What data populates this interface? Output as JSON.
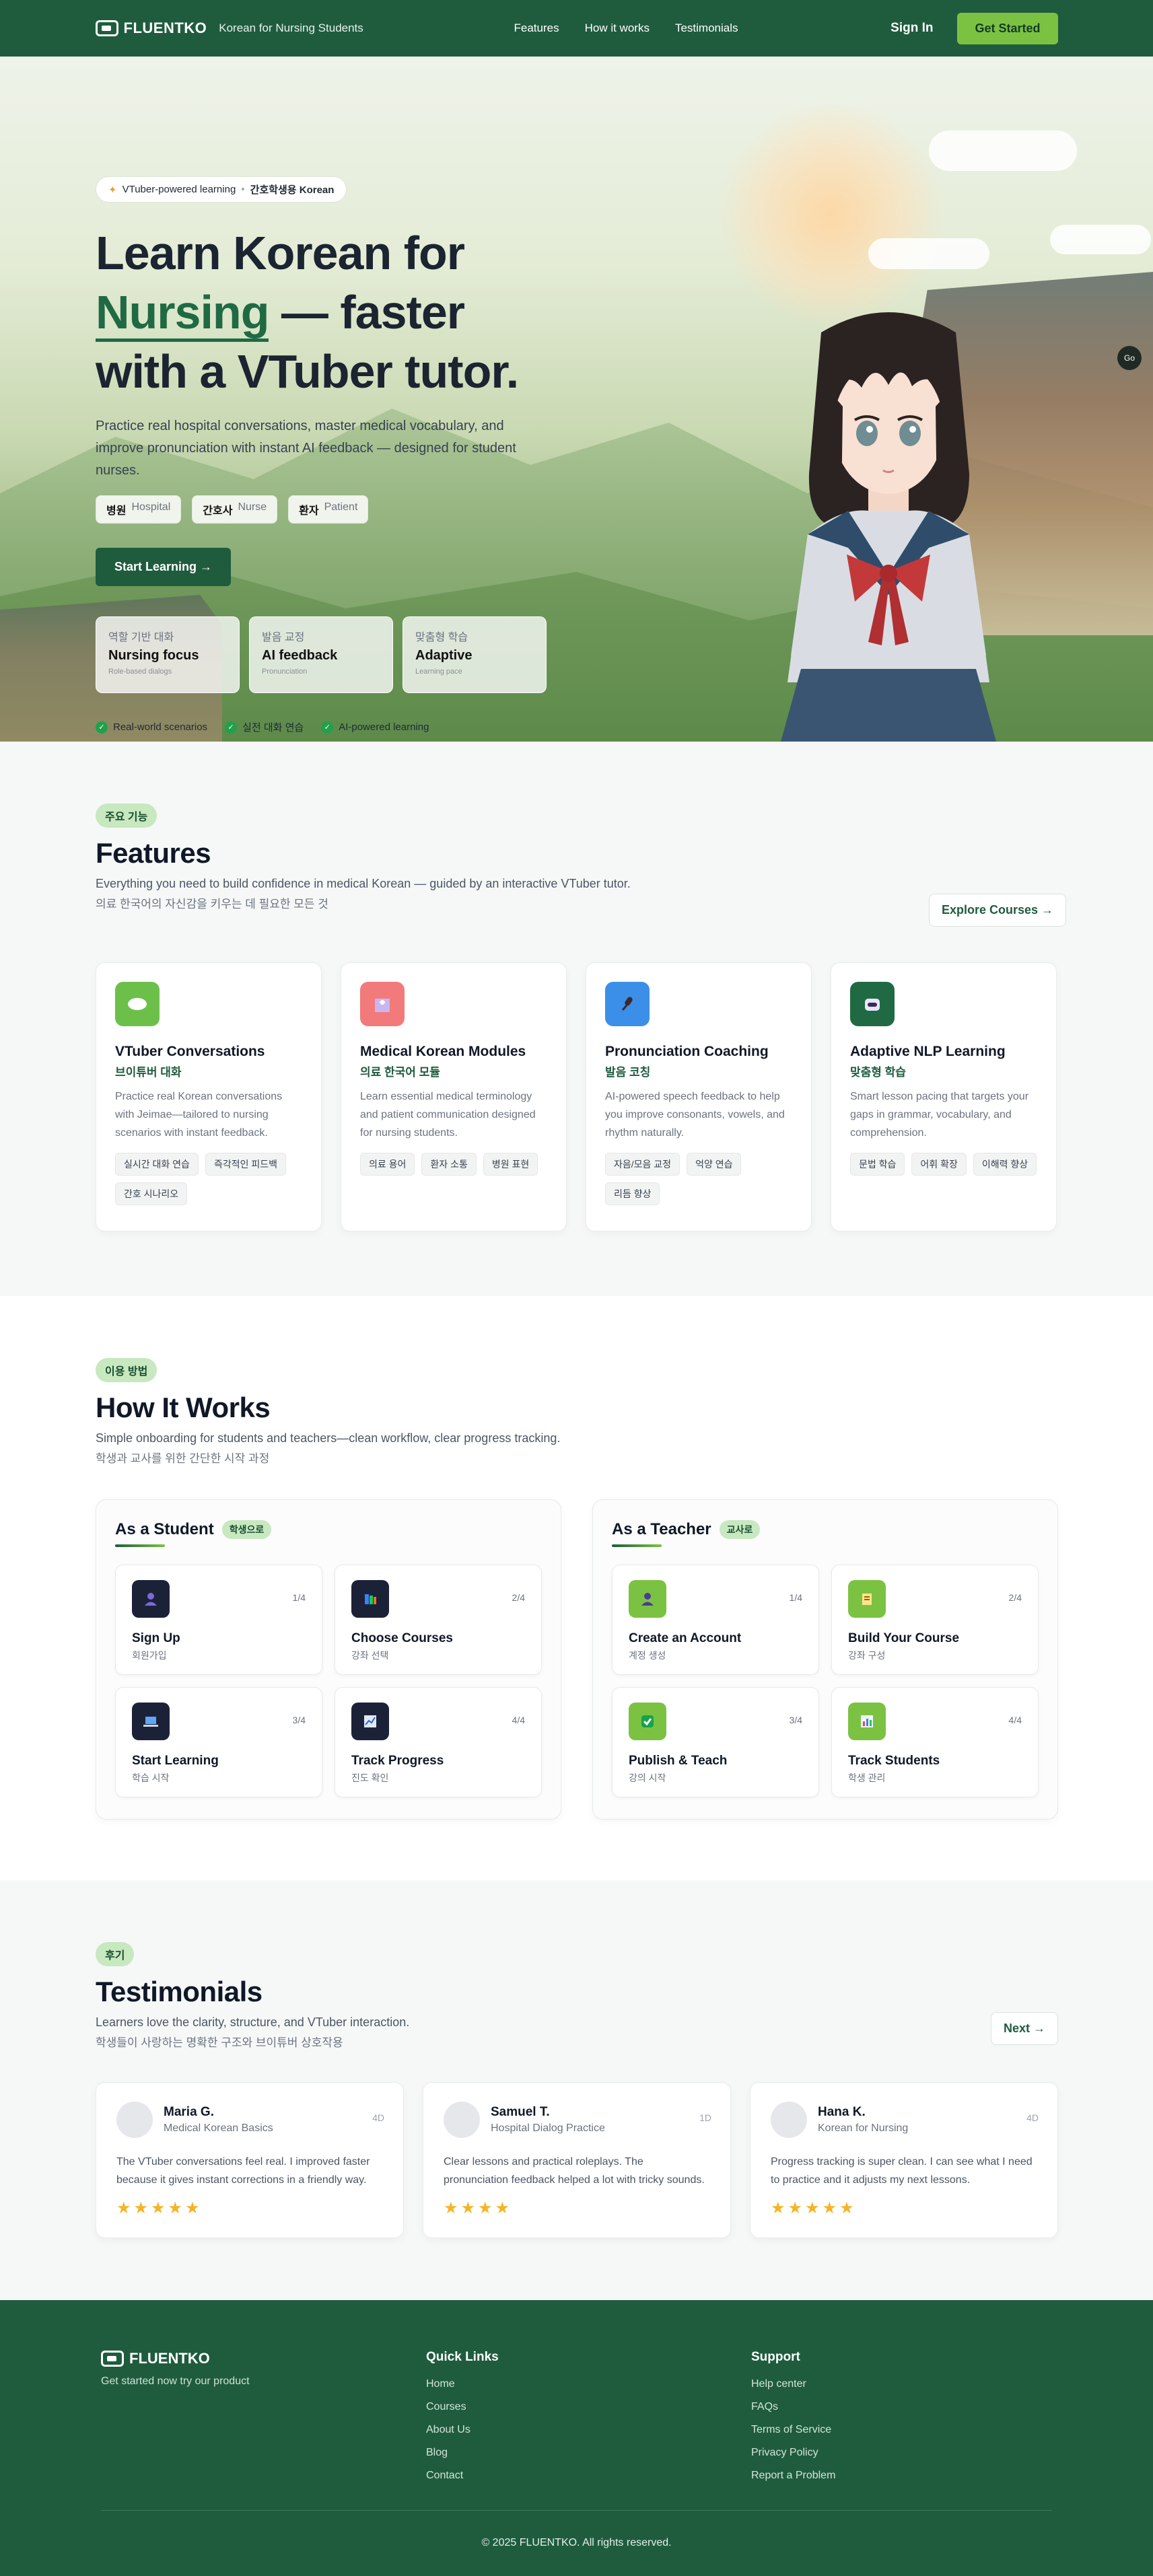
{
  "nav": {
    "logo": "FLUENTKO",
    "tagline": "Korean for Nursing Students",
    "links": [
      "Features",
      "How it works",
      "Testimonials"
    ],
    "sign_in": "Sign In",
    "cta": "Get Started"
  },
  "hero": {
    "pill_en": "VTuber-powered learning",
    "pill_sep": "•",
    "pill_kr": "간호학생용 Korean",
    "title_line1": "Learn Korean for",
    "title_accent": "Nursing",
    "title_line2_rest": " — faster",
    "title_line3": "with a VTuber tutor.",
    "description": "Practice real hospital conversations, master medical vocabulary, and improve pronunciation with instant AI feedback — designed for student nurses.",
    "chips": [
      {
        "kr": "병원",
        "en": "Hospital"
      },
      {
        "kr": "간호사",
        "en": "Nurse"
      },
      {
        "kr": "환자",
        "en": "Patient"
      }
    ],
    "cta": "Start Learning →",
    "stats": [
      {
        "kr": "역할 기반 대화",
        "en": "Nursing focus",
        "sub": "Role-based dialogs"
      },
      {
        "kr": "발음 교정",
        "en": "AI feedback",
        "sub": "Pronunciation"
      },
      {
        "kr": "맞춤형 학습",
        "en": "Adaptive",
        "sub": "Learning pace"
      }
    ],
    "checks": [
      "Real-world scenarios",
      "실전 대화 연습",
      "AI-powered learning"
    ]
  },
  "features": {
    "badge": "주요 기능",
    "title": "Features",
    "description": "Everything you need to build confidence in medical Korean — guided by an interactive VTuber tutor.",
    "description_kr": "의료 한국어의 자신감을 키우는 데 필요한 모든 것",
    "explore": "Explore Courses →",
    "cards": [
      {
        "title": "VTuber Conversations",
        "kr": "브이튜버 대화",
        "desc": "Practice real Korean conversations with Jeimae—tailored to nursing scenarios with instant feedback.",
        "tags": [
          "실시간 대화 연습",
          "즉각적인 피드백",
          "간호 시나리오"
        ],
        "icon": "chat-bubble-icon",
        "color": "#6cc04a"
      },
      {
        "title": "Medical Korean Modules",
        "kr": "의료 한국어 모듈",
        "desc": "Learn essential medical terminology and patient communication designed for nursing students.",
        "tags": [
          "의료 용어",
          "환자 소통",
          "병원 표현"
        ],
        "icon": "hospital-icon",
        "color": "#f27a7a"
      },
      {
        "title": "Pronunciation Coaching",
        "kr": "발음 코칭",
        "desc": "AI-powered speech feedback to help you improve consonants, vowels, and rhythm naturally.",
        "tags": [
          "자음/모음 교정",
          "억양 연습",
          "리듬 향상"
        ],
        "icon": "microphone-icon",
        "color": "#3b8fe8"
      },
      {
        "title": "Adaptive NLP Learning",
        "kr": "맞춤형 학습",
        "desc": "Smart lesson pacing that targets your gaps in grammar, vocabulary, and comprehension.",
        "tags": [
          "문법 학습",
          "어휘 확장",
          "이해력 향상"
        ],
        "icon": "robot-icon",
        "color": "#1f6a43"
      }
    ]
  },
  "how": {
    "badge": "이용 방법",
    "title": "How It Works",
    "description": "Simple onboarding for students and teachers—clean workflow, clear progress tracking.",
    "description_kr": "학생과 교사를 위한 간단한 시작 과정",
    "student": {
      "title": "As a Student",
      "badge": "학생으로",
      "steps": [
        {
          "title": "Sign Up",
          "kr": "회원가입",
          "count": "1/4",
          "icon": "user-icon"
        },
        {
          "title": "Choose Courses",
          "kr": "강좌 선택",
          "count": "2/4",
          "icon": "books-icon"
        },
        {
          "title": "Start Learning",
          "kr": "학습 시작",
          "count": "3/4",
          "icon": "laptop-icon"
        },
        {
          "title": "Track Progress",
          "kr": "진도 확인",
          "count": "4/4",
          "icon": "chart-icon"
        }
      ]
    },
    "teacher": {
      "title": "As a Teacher",
      "badge": "교사로",
      "steps": [
        {
          "title": "Create an Account",
          "kr": "계정 생성",
          "count": "1/4",
          "icon": "user-icon"
        },
        {
          "title": "Build Your Course",
          "kr": "강좌 구성",
          "count": "2/4",
          "icon": "notepad-icon"
        },
        {
          "title": "Publish & Teach",
          "kr": "강의 시작",
          "count": "3/4",
          "icon": "checkmark-icon"
        },
        {
          "title": "Track Students",
          "kr": "학생 관리",
          "count": "4/4",
          "icon": "bar-chart-icon"
        }
      ]
    }
  },
  "testimonials": {
    "badge": "후기",
    "title": "Testimonials",
    "description": "Learners love the clarity, structure, and VTuber interaction.",
    "description_kr": "학생들이 사랑하는 명확한 구조와 브이튜버 상호작용",
    "next": "Next →",
    "items": [
      {
        "name": "Maria G.",
        "role": "Medical Korean Basics",
        "ago": "4D",
        "text": "The VTuber conversations feel real. I improved faster because it gives instant corrections in a friendly way.",
        "rating": 5
      },
      {
        "name": "Samuel T.",
        "role": "Hospital Dialog Practice",
        "ago": "1D",
        "text": "Clear lessons and practical roleplays. The pronunciation feedback helped a lot with tricky sounds.",
        "rating": 4
      },
      {
        "name": "Hana K.",
        "role": "Korean for Nursing",
        "ago": "4D",
        "text": "Progress tracking is super clean. I can see what I need to practice and it adjusts my next lessons.",
        "rating": 5
      }
    ]
  },
  "footer": {
    "logo": "FLUENTKO",
    "subtitle": "Get started now try our product",
    "quick_links_title": "Quick Links",
    "quick_links": [
      "Home",
      "Courses",
      "About Us",
      "Blog",
      "Contact"
    ],
    "support_title": "Support",
    "support_links": [
      "Help center",
      "FAQs",
      "Terms of Service",
      "Privacy Policy",
      "Report a Problem"
    ],
    "copyright": "© 2025 FLUENTKO. All rights reserved."
  },
  "colors": {
    "brand_green": "#1f5c3e",
    "accent_lime": "#7cc242",
    "star": "#f6b324"
  }
}
